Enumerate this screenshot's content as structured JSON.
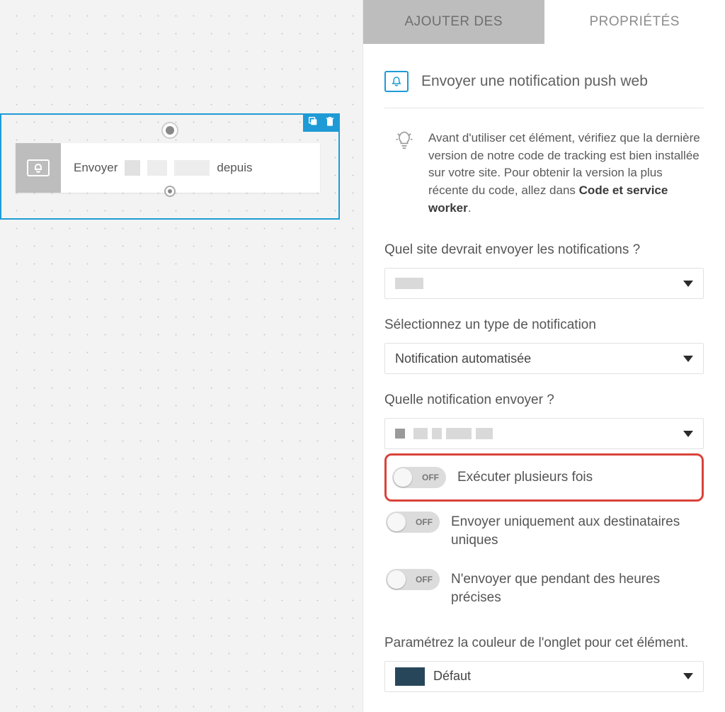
{
  "tabs": {
    "add": "AJOUTER DES",
    "properties": "PROPRIÉTÉS"
  },
  "node": {
    "text_before": "Envoyer",
    "text_after": "depuis"
  },
  "panel": {
    "title": "Envoyer une notification push web",
    "hint_prefix": "Avant d'utiliser cet élément, vérifiez que la dernière version de notre code de tracking est bien installée sur votre site. Pour obtenir la version la plus récente du code, allez dans ",
    "hint_bold": "Code et service worker",
    "hint_suffix": ".",
    "site_label": "Quel site devrait envoyer les notifications ?",
    "type_label": "Sélectionnez un type de notification",
    "type_value": "Notification automatisée",
    "which_label": "Quelle notification envoyer ?",
    "toggle_off": "OFF",
    "toggle1_label": "Exécuter plusieurs fois",
    "toggle2_label": "Envoyer uniquement aux destinataires uniques",
    "toggle3_label": "N'envoyer que pendant des heures précises",
    "color_label": "Paramétrez la couleur de l'onglet pour cet élément.",
    "color_value": "Défaut",
    "color_swatch": "#28465a"
  }
}
